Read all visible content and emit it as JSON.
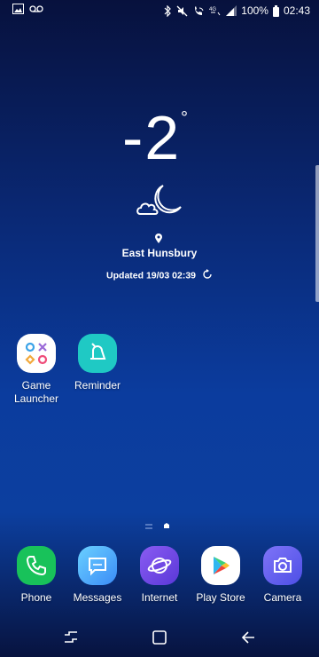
{
  "status_bar": {
    "left_icons": [
      "gallery-icon",
      "voicemail-icon"
    ],
    "right_icons": [
      "bluetooth-icon",
      "mute-icon",
      "wifi-call-icon",
      "volte-icon",
      "signal-icon",
      "battery-icon"
    ],
    "battery": "100%",
    "time": "02:43"
  },
  "weather": {
    "temperature": "-2",
    "degree_symbol": "°",
    "condition_icon": "moon-cloud-icon",
    "location": "East Hunsbury",
    "updated": "Updated 19/03 02:39"
  },
  "home_apps": [
    {
      "label": "Game\nLauncher",
      "icon": "game-launcher-icon"
    },
    {
      "label": "Reminder",
      "icon": "reminder-icon"
    }
  ],
  "dock": [
    {
      "label": "Phone",
      "icon": "phone-icon",
      "color": "#18c25a"
    },
    {
      "label": "Messages",
      "icon": "messages-icon",
      "color": "#47a9ff"
    },
    {
      "label": "Internet",
      "icon": "internet-icon",
      "color": "#6a48e8"
    },
    {
      "label": "Play Store",
      "icon": "play-store-icon",
      "color": "#ffffff"
    },
    {
      "label": "Camera",
      "icon": "camera-icon",
      "color": "#5a5ef0"
    }
  ],
  "nav": [
    "recents-button",
    "home-button",
    "back-button"
  ]
}
